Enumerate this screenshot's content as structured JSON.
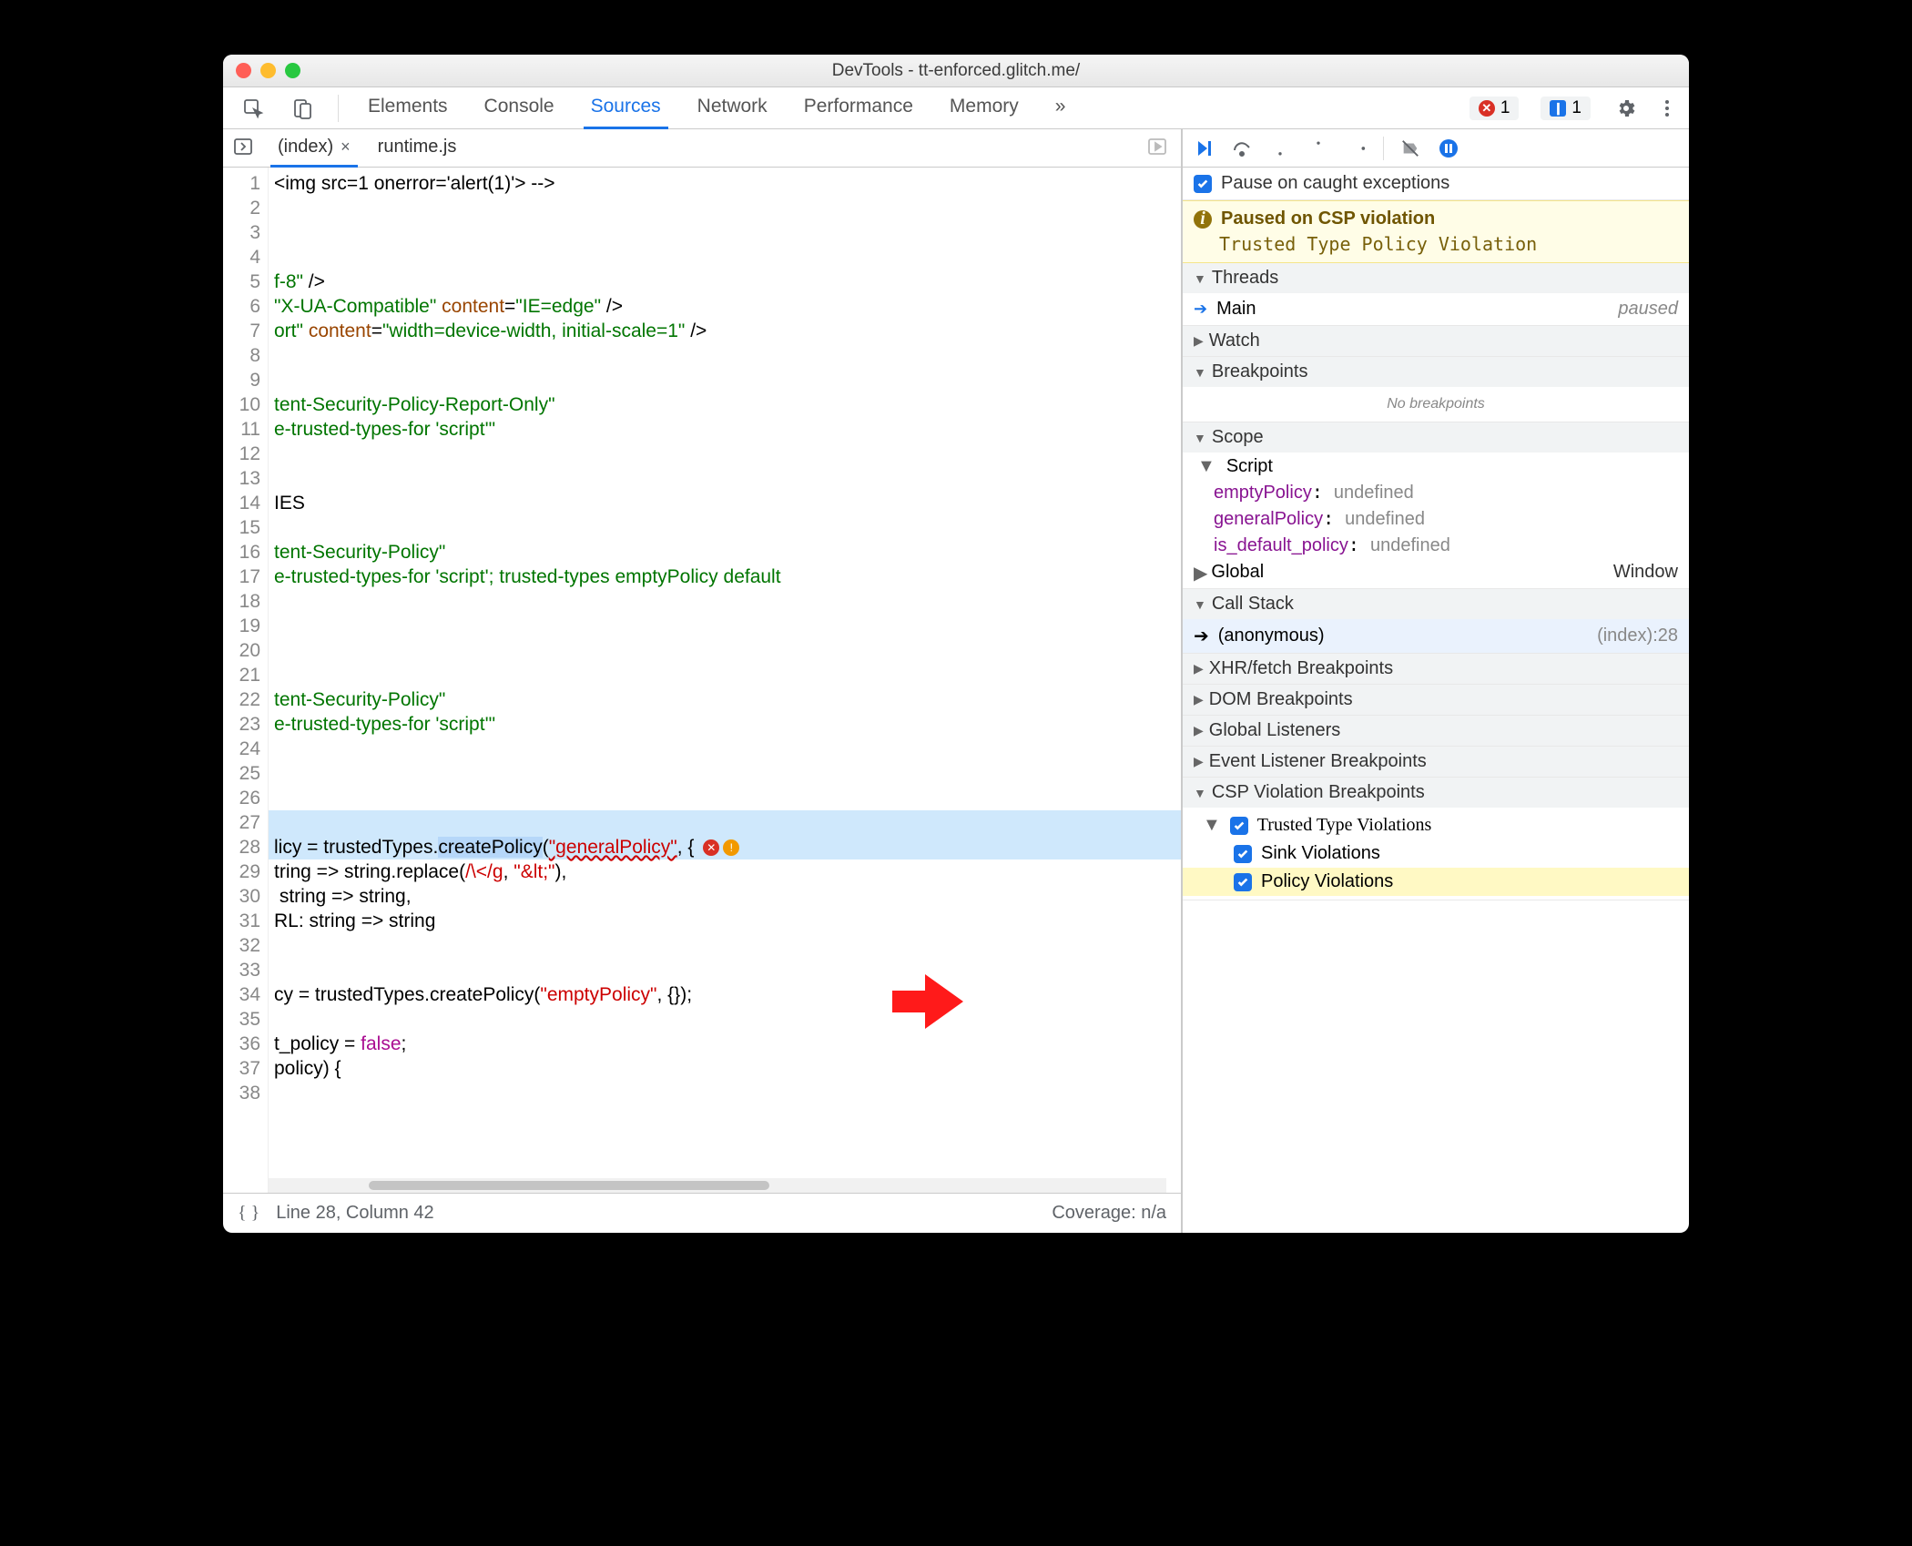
{
  "window": {
    "title": "DevTools - tt-enforced.glitch.me/"
  },
  "tabs": {
    "items": [
      "Elements",
      "Console",
      "Sources",
      "Network",
      "Performance",
      "Memory"
    ],
    "more": "»",
    "active": "Sources",
    "error_count": "1",
    "info_count": "1"
  },
  "source_tabs": {
    "items": [
      {
        "label": "(index)",
        "active": true,
        "closable": true
      },
      {
        "label": "runtime.js",
        "active": false,
        "closable": false
      }
    ]
  },
  "code": {
    "lines": [
      {
        "n": 1,
        "html": "&lt;img src=1 onerror='alert(1)'&gt; --&gt;",
        "cls": "tok-tag"
      },
      {
        "n": 2,
        "html": ""
      },
      {
        "n": 3,
        "html": ""
      },
      {
        "n": 4,
        "html": ""
      },
      {
        "n": 5,
        "html": "<span class='tok-green'>f-8\"</span> /&gt;"
      },
      {
        "n": 6,
        "html": "<span class='tok-green'>\"X-UA-Compatible\"</span> <span class='tok-attr'>content</span>=<span class='tok-green'>\"IE=edge\"</span> /&gt;"
      },
      {
        "n": 7,
        "html": "<span class='tok-green'>ort\"</span> <span class='tok-attr'>content</span>=<span class='tok-green'>\"width=device-width, initial-scale=1\"</span> /&gt;"
      },
      {
        "n": 8,
        "html": ""
      },
      {
        "n": 9,
        "html": ""
      },
      {
        "n": 10,
        "html": "<span class='tok-green'>tent-Security-Policy-Report-Only\"</span>"
      },
      {
        "n": 11,
        "html": "<span class='tok-green'>e-trusted-types-for 'script'\"</span>"
      },
      {
        "n": 12,
        "html": ""
      },
      {
        "n": 13,
        "html": ""
      },
      {
        "n": 14,
        "html": "IES"
      },
      {
        "n": 15,
        "html": ""
      },
      {
        "n": 16,
        "html": "<span class='tok-green'>tent-Security-Policy\"</span>"
      },
      {
        "n": 17,
        "html": "<span class='tok-green'>e-trusted-types-for 'script'; trusted-types emptyPolicy default</span>"
      },
      {
        "n": 18,
        "html": ""
      },
      {
        "n": 19,
        "html": ""
      },
      {
        "n": 20,
        "html": ""
      },
      {
        "n": 21,
        "html": ""
      },
      {
        "n": 22,
        "html": "<span class='tok-green'>tent-Security-Policy\"</span>"
      },
      {
        "n": 23,
        "html": "<span class='tok-green'>e-trusted-types-for 'script'\"</span>"
      },
      {
        "n": 24,
        "html": ""
      },
      {
        "n": 25,
        "html": ""
      },
      {
        "n": 26,
        "html": ""
      },
      {
        "n": 27,
        "html": "",
        "hl": true
      },
      {
        "n": 28,
        "html": "licy = trustedTypes.<span style='background:#b6d7f9'>createPolicy</span>(<span class='tok-err'>\"generalPolicy\"</span>, { <span class='ln-badge lnb-red'>✕</span><span class='ln-badge lnb-org'>!</span>",
        "hl": true,
        "break": true
      },
      {
        "n": 29,
        "html": "tring =&gt; string.replace(<span style='color:#c00'>/\\&lt;/g</span>, <span style='color:#c00'>\"&amp;lt;\"</span>),"
      },
      {
        "n": 30,
        "html": " string =&gt; string,"
      },
      {
        "n": 31,
        "html": "RL: string =&gt; string"
      },
      {
        "n": 32,
        "html": ""
      },
      {
        "n": 33,
        "html": ""
      },
      {
        "n": 34,
        "html": "cy = trustedTypes.createPolicy(<span style='color:#c00'>\"emptyPolicy\"</span>, {});"
      },
      {
        "n": 35,
        "html": ""
      },
      {
        "n": 36,
        "html": "t_policy = <span class='tok-kw'>false</span>;"
      },
      {
        "n": 37,
        "html": "policy) {"
      },
      {
        "n": 38,
        "html": ""
      }
    ]
  },
  "status": {
    "line_col": "Line 28, Column 42",
    "coverage": "Coverage: n/a"
  },
  "debug": {
    "pause_exceptions": "Pause on caught exceptions",
    "paused_title": "Paused on CSP violation",
    "paused_detail": "Trusted Type Policy Violation",
    "threads_title": "Threads",
    "thread_main": "Main",
    "thread_paused": "paused",
    "watch_title": "Watch",
    "breakpoints_title": "Breakpoints",
    "no_breakpoints": "No breakpoints",
    "scope_title": "Scope",
    "scope_script": "Script",
    "scope_vars": [
      {
        "name": "emptyPolicy",
        "value": "undefined"
      },
      {
        "name": "generalPolicy",
        "value": "undefined"
      },
      {
        "name": "is_default_policy",
        "value": "undefined"
      }
    ],
    "scope_global": "Global",
    "scope_global_val": "Window",
    "callstack_title": "Call Stack",
    "callstack_fn": "(anonymous)",
    "callstack_loc": "(index):28",
    "xhr_title": "XHR/fetch Breakpoints",
    "dom_title": "DOM Breakpoints",
    "glob_title": "Global Listeners",
    "evt_title": "Event Listener Breakpoints",
    "csp_bp_title": "CSP Violation Breakpoints",
    "csp_items": {
      "parent": "Trusted Type Violations",
      "sink": "Sink Violations",
      "policy": "Policy Violations"
    }
  }
}
